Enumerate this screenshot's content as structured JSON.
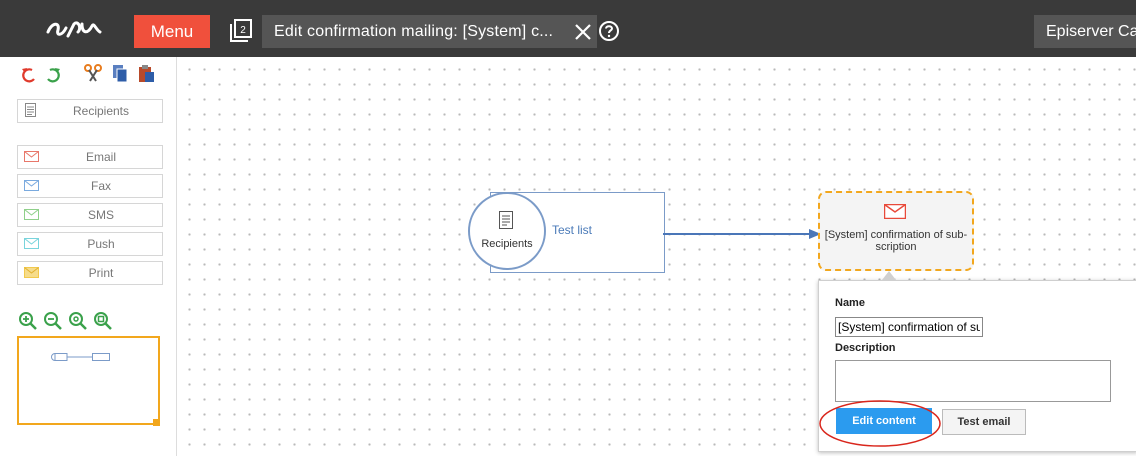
{
  "topbar": {
    "menu_label": "Menu",
    "tab_title": "Edit confirmation mailing: [System] c...",
    "site_label": "Episerver Ca"
  },
  "toolbar": {
    "tools": [
      "undo-icon",
      "redo-icon",
      "cut-icon",
      "copy-icon",
      "paste-icon"
    ]
  },
  "palette": {
    "recipients": "Recipients",
    "channels": [
      "Email",
      "Fax",
      "SMS",
      "Push",
      "Print"
    ],
    "channel_colors": [
      "#e8776a",
      "#7aaadf",
      "#8fd08a",
      "#79d4dc",
      "#f2c94c"
    ]
  },
  "zoom_tools": [
    "zoom-in-icon",
    "zoom-out-icon",
    "zoom-reset-icon",
    "zoom-fit-icon"
  ],
  "flow": {
    "recipients_label": "Recipients",
    "test_list_label": "Test list",
    "email_node_label": "[System] confirmation of sub-scription"
  },
  "popup": {
    "name_label": "Name",
    "name_value": "[System] confirmation of su",
    "description_label": "Description",
    "description_value": "",
    "edit_content_label": "Edit content",
    "test_email_label": "Test email"
  },
  "colors": {
    "accent": "#f0503c",
    "selection": "#f2a71d",
    "primary_button": "#2b9bef",
    "highlight": "#d9261c"
  }
}
